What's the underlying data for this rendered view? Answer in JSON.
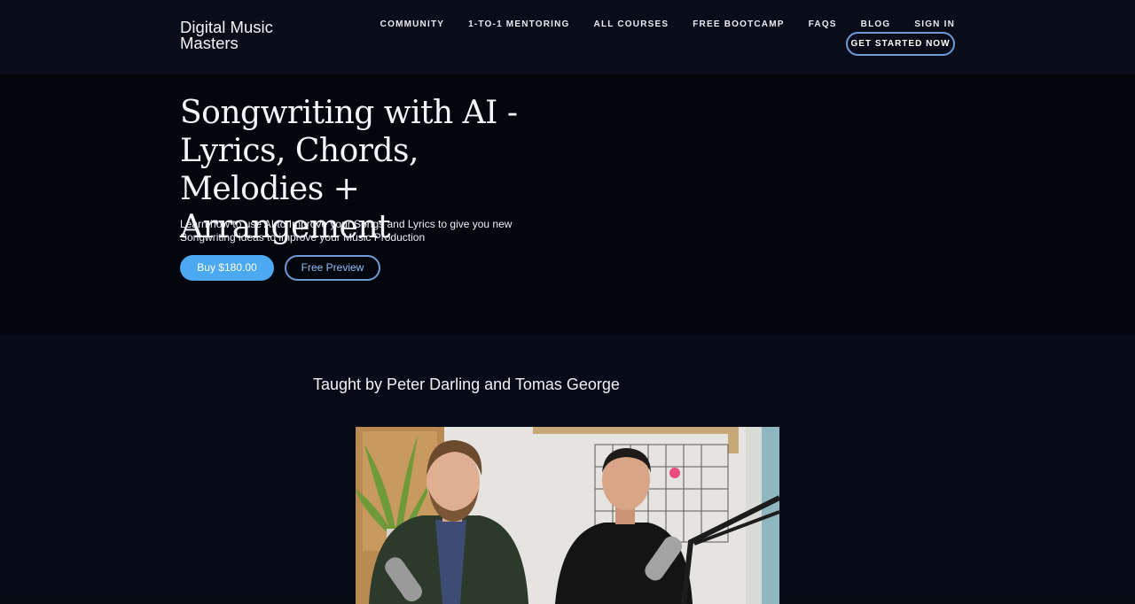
{
  "header": {
    "logo": {
      "line1": "Digital Music",
      "line2": "Masters"
    },
    "nav": [
      {
        "label": "COMMUNITY"
      },
      {
        "label": "1-TO-1 MENTORING"
      },
      {
        "label": "ALL COURSES"
      },
      {
        "label": "FREE BOOTCAMP"
      },
      {
        "label": "FAQS"
      },
      {
        "label": "BLOG"
      },
      {
        "label": "SIGN IN"
      }
    ],
    "cta_label": "GET STARTED NOW"
  },
  "hero": {
    "title": "Songwriting with AI - Lyrics, Chords, Melodies + Arrangement",
    "subtitle": "Learn how to use AI to Improve your Songs and Lyrics to give you new Songwriting ideas to improve your Music Production",
    "buy_label": "Buy $180.00",
    "preview_label": "Free Preview"
  },
  "instructors": {
    "heading": "Taught by Peter Darling and Tomas George"
  },
  "colors": {
    "accent": "#4aa9f0",
    "outline": "#6e9bd6",
    "background": "#03060d"
  }
}
